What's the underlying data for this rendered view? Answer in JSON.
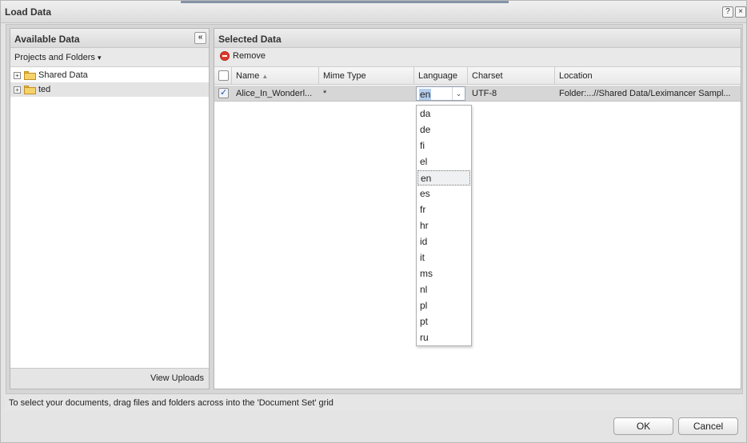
{
  "window": {
    "title": "Load Data",
    "help_icon": "?",
    "close_icon": "×"
  },
  "left_panel": {
    "title": "Available Data",
    "collapse_icon": "«",
    "dropdown_label": "Projects and Folders",
    "dropdown_caret": "▾",
    "tree": [
      {
        "label": "Shared Data",
        "expander": "+"
      },
      {
        "label": "ted",
        "expander": "+"
      }
    ],
    "footer_link": "View Uploads"
  },
  "right_panel": {
    "title": "Selected Data",
    "remove_label": "Remove",
    "columns": [
      "Name",
      "Mime Type",
      "Language",
      "Charset",
      "Location"
    ],
    "sort_indicator": "▲",
    "row": {
      "checked": true,
      "name": "Alice_In_Wonderl...",
      "mime_type": "*",
      "language": "en",
      "charset": "UTF-8",
      "location": "Folder:...//Shared Data/Leximancer Sampl..."
    },
    "combo_caret": "⌄"
  },
  "language_dropdown": {
    "options": [
      "da",
      "de",
      "fi",
      "el",
      "en",
      "es",
      "fr",
      "hr",
      "id",
      "it",
      "ms",
      "nl",
      "pl",
      "pt",
      "ru"
    ],
    "selected": "en"
  },
  "status_text": "To select your documents, drag files and folders across into the 'Document Set' grid",
  "buttons": {
    "ok": "OK",
    "cancel": "Cancel"
  }
}
